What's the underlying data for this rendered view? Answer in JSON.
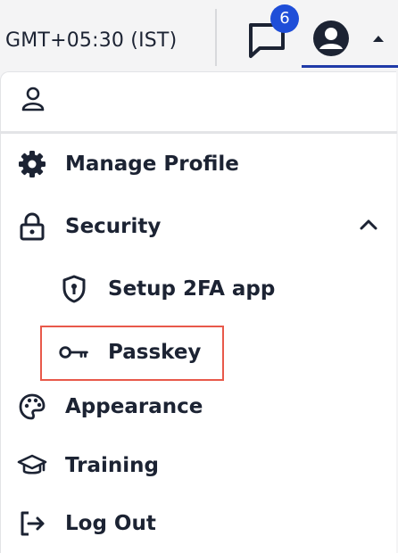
{
  "topbar": {
    "timezone": "GMT+05:30 (IST)",
    "notification_count": "6"
  },
  "menu": {
    "items": [
      {
        "label": "Manage Profile",
        "icon": "gear-icon"
      },
      {
        "label": "Security",
        "icon": "lock-icon",
        "expanded": true
      },
      {
        "label": "Setup 2FA app",
        "icon": "shield-icon"
      },
      {
        "label": "Passkey",
        "icon": "key-icon",
        "highlighted": true
      },
      {
        "label": "Appearance",
        "icon": "palette-icon"
      },
      {
        "label": "Training",
        "icon": "graduation-cap-icon"
      },
      {
        "label": "Log Out",
        "icon": "logout-icon"
      }
    ]
  },
  "colors": {
    "badge": "#1f4ed8",
    "active_underline": "#1f3aa8",
    "highlight_border": "#e8594a",
    "text": "#1c2333"
  }
}
